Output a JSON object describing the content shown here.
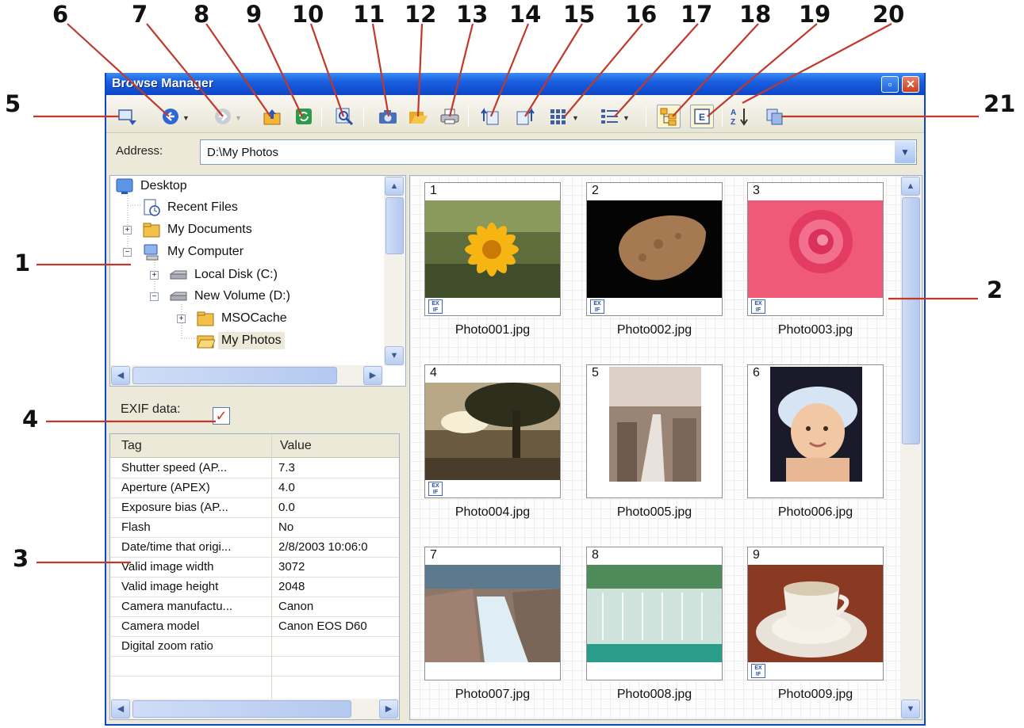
{
  "window": {
    "title": "Browse Manager"
  },
  "callouts": [
    "1",
    "2",
    "3",
    "4",
    "5",
    "6",
    "7",
    "8",
    "9",
    "10",
    "11",
    "12",
    "13",
    "14",
    "15",
    "16",
    "17",
    "18",
    "19",
    "20",
    "21"
  ],
  "toolbar": {
    "icons": [
      "select-source-icon",
      "back-icon",
      "forward-icon",
      "up-folder-icon",
      "refresh-icon",
      "find-icon",
      "camera-icon",
      "open-folder-icon",
      "print-icon",
      "rotate-left-icon",
      "rotate-right-icon",
      "thumbnail-view-icon",
      "details-view-icon",
      "folder-tree-icon",
      "exif-panel-icon",
      "sort-icon",
      "copy-icon"
    ]
  },
  "address": {
    "label": "Address:",
    "value": "D:\\My Photos"
  },
  "tree": {
    "items": [
      {
        "label": "Desktop",
        "icon": "desktop-icon"
      },
      {
        "label": "Recent Files",
        "icon": "recent-files-icon"
      },
      {
        "label": "My Documents",
        "icon": "folder-icon",
        "expander": "+"
      },
      {
        "label": "My Computer",
        "icon": "computer-icon",
        "expander": "−"
      },
      {
        "label": "Local Disk (C:)",
        "icon": "drive-icon",
        "expander": "+"
      },
      {
        "label": "New Volume (D:)",
        "icon": "drive-icon",
        "expander": "−"
      },
      {
        "label": "MSOCache",
        "icon": "folder-icon",
        "expander": "+"
      },
      {
        "label": "My Photos",
        "icon": "folder-icon",
        "selected": true
      }
    ]
  },
  "exif": {
    "label": "EXIF data:",
    "checked": true,
    "columns": [
      "Tag",
      "Value"
    ],
    "rows": [
      {
        "tag": "Shutter speed (AP...",
        "value": "7.3"
      },
      {
        "tag": "Aperture (APEX)",
        "value": "4.0"
      },
      {
        "tag": "Exposure bias (AP...",
        "value": "0.0"
      },
      {
        "tag": "Flash",
        "value": "No"
      },
      {
        "tag": "Date/time that origi...",
        "value": "2/8/2003 10:06:0"
      },
      {
        "tag": "Valid image width",
        "value": "3072"
      },
      {
        "tag": "Valid image height",
        "value": "2048"
      },
      {
        "tag": "Camera manufactu...",
        "value": "Canon"
      },
      {
        "tag": "Camera model",
        "value": "Canon EOS D60"
      },
      {
        "tag": "Digital zoom ratio",
        "value": ""
      }
    ]
  },
  "thumbnails": [
    {
      "num": "1",
      "name": "Photo001.jpg",
      "exif": true
    },
    {
      "num": "2",
      "name": "Photo002.jpg",
      "exif": true
    },
    {
      "num": "3",
      "name": "Photo003.jpg",
      "exif": true
    },
    {
      "num": "4",
      "name": "Photo004.jpg",
      "exif": true
    },
    {
      "num": "5",
      "name": "Photo005.jpg",
      "exif": false
    },
    {
      "num": "6",
      "name": "Photo006.jpg",
      "exif": false
    },
    {
      "num": "7",
      "name": "Photo007.jpg",
      "exif": false
    },
    {
      "num": "8",
      "name": "Photo008.jpg",
      "exif": false
    },
    {
      "num": "9",
      "name": "Photo009.jpg",
      "exif": true
    }
  ],
  "colors": {
    "titlebar": "#1a5fe0",
    "window": "#ece9d8",
    "selection": "#ece9d8",
    "check": "#d03a2a"
  }
}
